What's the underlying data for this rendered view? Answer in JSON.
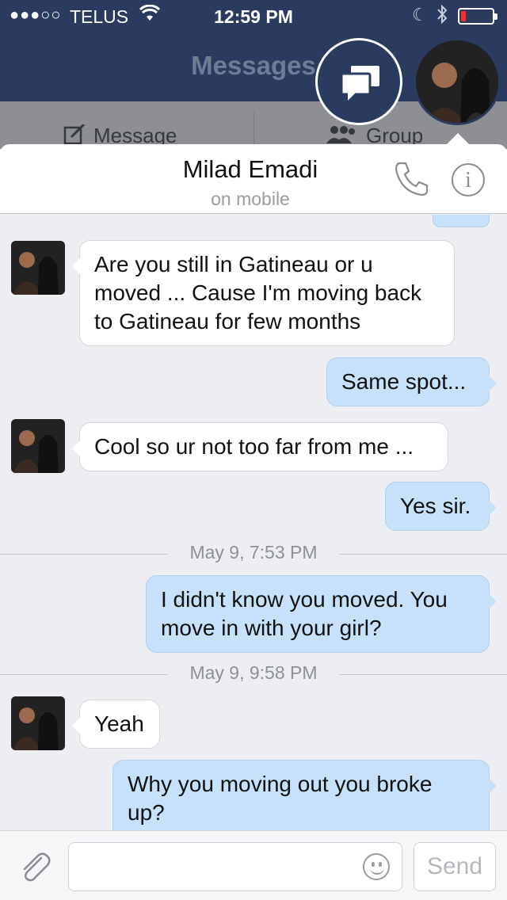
{
  "status_bar": {
    "signal": "●●●○○",
    "carrier": "TELUS",
    "time": "12:59 PM",
    "battery_level": 0.15
  },
  "nav": {
    "title": "Messages"
  },
  "toolbar": {
    "message_label": "Message",
    "group_label": "Group"
  },
  "conversation": {
    "contact_name": "Milad Emadi",
    "contact_status": "on mobile"
  },
  "messages": [
    {
      "from": "them",
      "text": "Are you still in Gatineau or u moved ... Cause I'm moving back to Gatineau for few months"
    },
    {
      "from": "me",
      "text": "Same spot..."
    },
    {
      "from": "them",
      "text": "Cool so ur not too far from me ..."
    },
    {
      "from": "me",
      "text": "Yes sir."
    },
    {
      "from": "me",
      "text": "I didn't know you moved.  You move in with your girl?"
    },
    {
      "from": "them",
      "text": "Yeah"
    },
    {
      "from": "me",
      "text": "Why you moving out you broke up?"
    }
  ],
  "timestamps": [
    "May 9, 7:53 PM",
    "May 9, 9:58 PM"
  ],
  "composer": {
    "input_value": "",
    "send_label": "Send"
  },
  "colors": {
    "nav_bg": "#2a3b5f",
    "outgoing_bubble": "#c7e1fb",
    "incoming_bubble": "#ffffff",
    "thread_bg": "#edeef2"
  }
}
